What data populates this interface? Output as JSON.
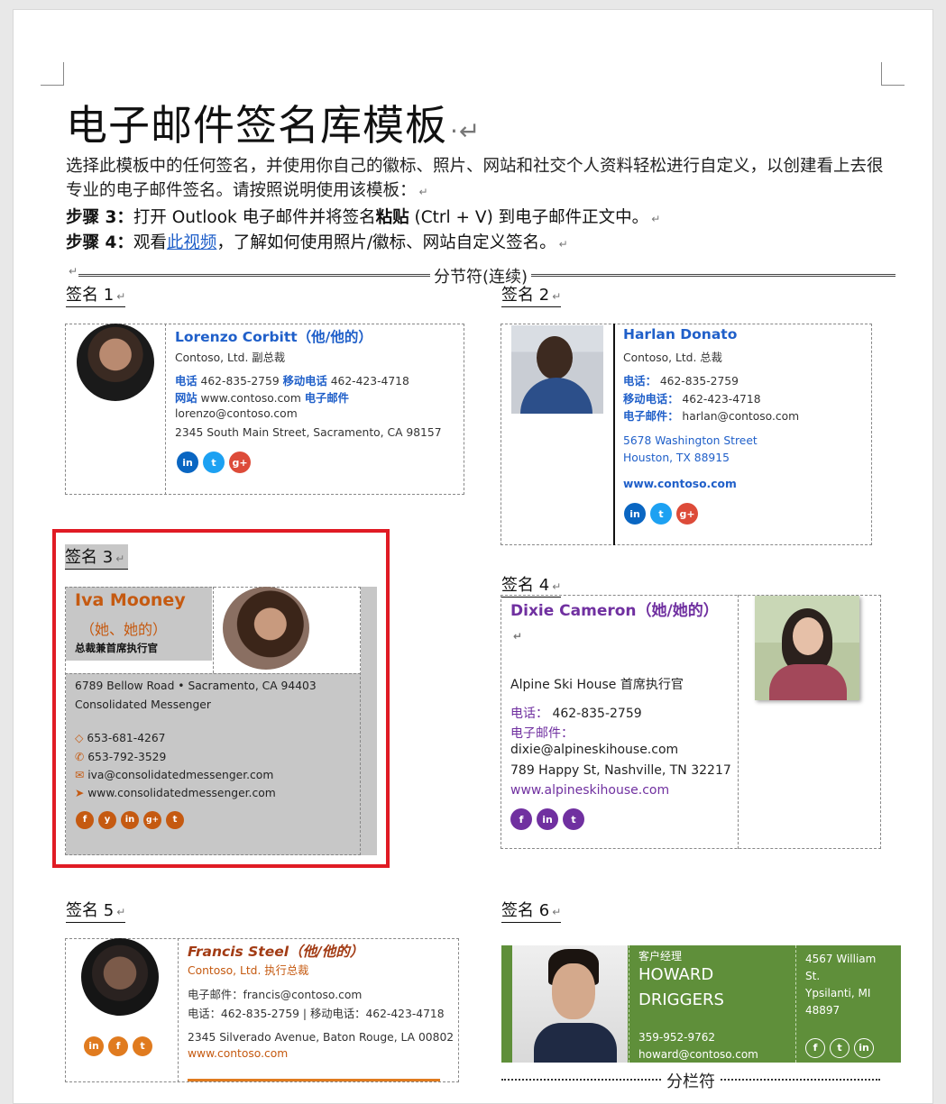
{
  "header": {
    "title": "电子邮件签名库模板",
    "intro": "选择此模板中的任何签名，并使用你自己的徽标、照片、网站和社交个人资料轻松进行自定义，以创建看上去很专业的电子邮件签名。请按照说明使用该模板：",
    "step3": {
      "label": "步骤 3：",
      "text_a": "打开 Outlook 电子邮件并将签名",
      "bold": "粘贴",
      "text_b": " (Ctrl + V) 到电子邮件正文中。"
    },
    "step4": {
      "label": "步骤 4：",
      "text_a": "观看",
      "link": "此视频",
      "text_b": "，了解如何使用照片/徽标、网站自定义签名。"
    },
    "section_break": "分节符(连续)",
    "column_break": "分栏符"
  },
  "sig1": {
    "label": "签名 1",
    "name": "Lorenzo Corbitt（他/他的）",
    "title": "Contoso, Ltd. 副总裁",
    "phone_label": "电话",
    "phone": "462-835-2759",
    "mobile_label": "移动电话",
    "mobile": "462-423-4718",
    "web_label": "网站",
    "web": "www.contoso.com",
    "email_label": "电子邮件",
    "email": "lorenzo@contoso.com",
    "address": "2345 South Main Street, Sacramento, CA 98157",
    "social": [
      "in",
      "t",
      "g+"
    ]
  },
  "sig2": {
    "label": "签名 2",
    "name": "Harlan Donato",
    "title": "Contoso, Ltd. 总裁",
    "phone_label": "电话：",
    "phone": "462-835-2759",
    "mobile_label": "移动电话：",
    "mobile": "462-423-4718",
    "email_label": "电子邮件：",
    "email": "harlan@contoso.com",
    "address1": "5678 Washington Street",
    "address2": "Houston, TX 88915",
    "web": "www.contoso.com",
    "social": [
      "in",
      "t",
      "g+"
    ]
  },
  "sig3": {
    "label": "签名 3",
    "name": "Iva Mooney",
    "pronoun": "（她、她的）",
    "title": "总裁兼首席执行官",
    "address": "6789 Bellow Road • Sacramento, CA 94403",
    "company": "Consolidated Messenger",
    "phone1": "653-681-4267",
    "phone2": "653-792-3529",
    "email": "iva@consolidatedmessenger.com",
    "web": "www.consolidatedmessenger.com",
    "social": [
      "f",
      "y",
      "in",
      "g+",
      "t"
    ]
  },
  "sig4": {
    "label": "签名 4",
    "name": "Dixie Cameron（她/她的）",
    "title": "Alpine Ski House 首席执行官",
    "phone_label": "电话：",
    "phone": "462-835-2759",
    "email_label": "电子邮件：",
    "email": "dixie@alpineskihouse.com",
    "address": "789 Happy St, Nashville, TN 32217",
    "web": "www.alpineskihouse.com",
    "social": [
      "f",
      "in",
      "t"
    ]
  },
  "sig5": {
    "label": "签名 5",
    "name": "Francis Steel（他/他的）",
    "title": "Contoso, Ltd. 执行总裁",
    "email_line": "电子邮件：francis@contoso.com",
    "phone_line": "电话：462-835-2759 | 移动电话：462-423-4718",
    "address": "2345 Silverado Avenue, Baton Rouge, LA 00802",
    "web": "www.contoso.com",
    "social": [
      "in",
      "f",
      "t"
    ]
  },
  "sig6": {
    "label": "签名 6",
    "role": "客户经理",
    "first": "HOWARD",
    "last": "DRIGGERS",
    "phone": "359-952-9762",
    "email": "howard@contoso.com",
    "address1": "4567 William",
    "address2": "St.",
    "address3": "Ypsilanti, MI",
    "address4": "48897",
    "social": [
      "f",
      "t",
      "in"
    ]
  },
  "colors": {
    "blue": "#1f5fc9",
    "purple": "#7030a0",
    "orange": "#c55a11",
    "green": "#5f8f3a",
    "highlight_red": "#e01b24"
  }
}
